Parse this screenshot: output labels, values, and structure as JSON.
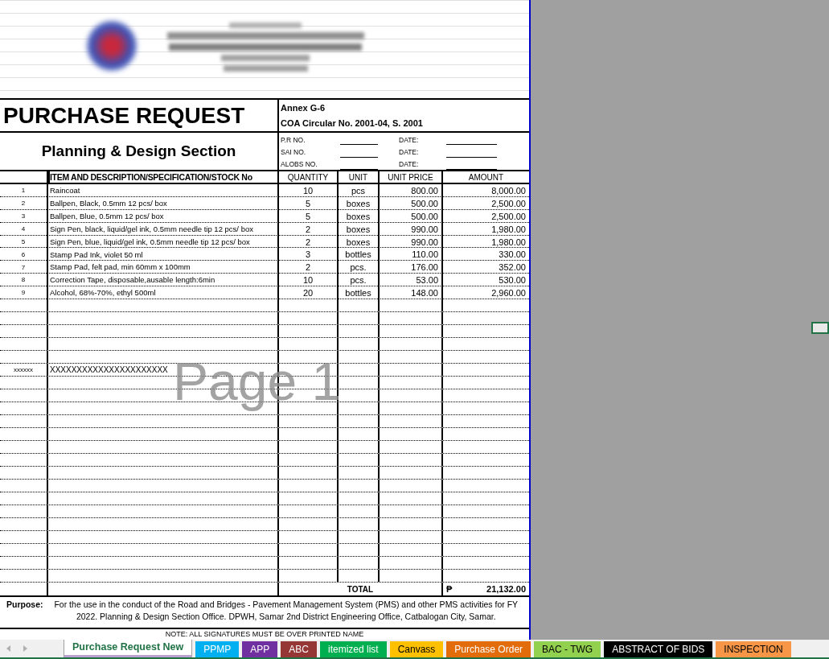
{
  "title": "PURCHASE REQUEST",
  "section": "Planning & Design Section",
  "annex": "Annex G-6",
  "circular": "COA Circular No. 2001-04, S. 2001",
  "ref_fields": [
    {
      "label": "P.R NO.",
      "date_label": "DATE:"
    },
    {
      "label": "SAI NO.",
      "date_label": "DATE:"
    },
    {
      "label": "ALOBS NO.",
      "date_label": "DATE:"
    }
  ],
  "columns": [
    "",
    "ITEM AND DESCRIPTION/SPECIFICATION/STOCK No",
    "QUANTITY",
    "UNIT",
    "UNIT PRICE",
    "AMOUNT"
  ],
  "rows": [
    {
      "no": "1",
      "description": "Raincoat",
      "quantity": "10",
      "unit": "pcs",
      "unit_price": "800.00",
      "amount": "8,000.00"
    },
    {
      "no": "2",
      "description": "Ballpen, Black, 0.5mm 12 pcs/ box",
      "quantity": "5",
      "unit": "boxes",
      "unit_price": "500.00",
      "amount": "2,500.00"
    },
    {
      "no": "3",
      "description": "Ballpen, Blue, 0.5mm 12 pcs/ box",
      "quantity": "5",
      "unit": "boxes",
      "unit_price": "500.00",
      "amount": "2,500.00"
    },
    {
      "no": "4",
      "description": "Sign Pen, black, liquid/gel ink, 0.5mm needle tip 12 pcs/ box",
      "quantity": "2",
      "unit": "boxes",
      "unit_price": "990.00",
      "amount": "1,980.00"
    },
    {
      "no": "5",
      "description": "Sign Pen, blue, liquid/gel ink, 0.5mm needle tip 12 pcs/ box",
      "quantity": "2",
      "unit": "boxes",
      "unit_price": "990.00",
      "amount": "1,980.00"
    },
    {
      "no": "6",
      "description": "Stamp Pad Ink, violet 50 ml",
      "quantity": "3",
      "unit": "bottles",
      "unit_price": "110.00",
      "amount": "330.00"
    },
    {
      "no": "7",
      "description": "Stamp Pad, felt pad, min 60mm x 100mm",
      "quantity": "2",
      "unit": "pcs.",
      "unit_price": "176.00",
      "amount": "352.00"
    },
    {
      "no": "8",
      "description": "Correction Tape, disposable,ausable length:6min",
      "quantity": "10",
      "unit": "pcs.",
      "unit_price": "53.00",
      "amount": "530.00"
    },
    {
      "no": "9",
      "description": "Alcohol, 68%-70%, ethyl 500ml",
      "quantity": "20",
      "unit": "bottles",
      "unit_price": "148.00",
      "amount": "2,960.00"
    }
  ],
  "filler_row": {
    "no": "xxxxxx",
    "description": "XXXXXXXXXXXXXXXXXXXXXX"
  },
  "total": {
    "label": "TOTAL",
    "currency": "₱",
    "amount": "21,132.00"
  },
  "purpose": {
    "label": "Purpose:",
    "text": "For the use in the conduct of the Road and Bridges - Pavement Management System (PMS) and other PMS activities for FY 2022. Planning & Design Section Office. DPWH, Samar 2nd District Engineering Office, Catbalogan City, Samar."
  },
  "note": "NOTE: ALL SIGNATURES MUST BE OVER PRINTED NAME",
  "page_label": "Page 1",
  "sheet_tabs": [
    {
      "label": "Purchase Request New",
      "color": "#ffffff",
      "selected": true
    },
    {
      "label": "PPMP",
      "color": "#00b0f0",
      "selected": false
    },
    {
      "label": "APP",
      "color": "#7030a0",
      "selected": false
    },
    {
      "label": "ABC",
      "color": "#953735",
      "selected": false
    },
    {
      "label": "itemized list",
      "color": "#00b050",
      "selected": false
    },
    {
      "label": "Canvass",
      "color": "#ffc000",
      "selected": false
    },
    {
      "label": "Purchase Order",
      "color": "#e26b0a",
      "selected": false
    },
    {
      "label": "BAC - TWG",
      "color": "#92d050",
      "selected": false
    },
    {
      "label": "ABSTRACT OF BIDS",
      "color": "#000000",
      "selected": false
    },
    {
      "label": "INSPECTION",
      "color": "#f79646",
      "selected": false
    }
  ]
}
